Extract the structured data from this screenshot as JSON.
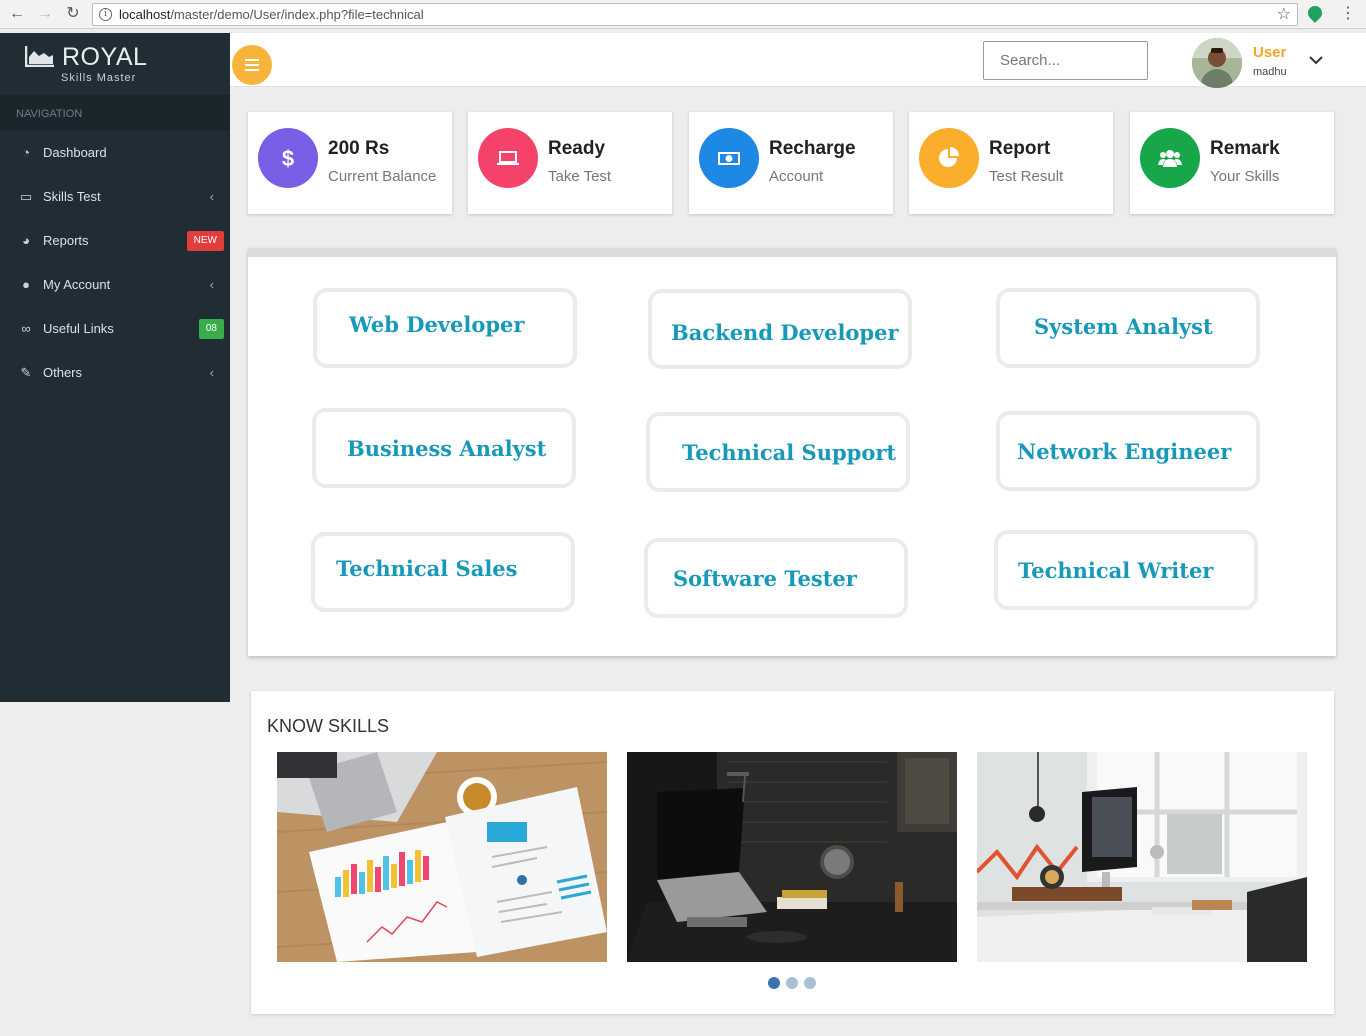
{
  "browser": {
    "url_host": "localhost",
    "url_path": "/master/demo/User/index.php?file=technical",
    "info_glyph": "i",
    "back_glyph": "←",
    "forward_glyph": "→",
    "reload_glyph": "↻",
    "star_glyph": "☆",
    "menu_glyph": "⋮"
  },
  "brand": {
    "title": "ROYAL",
    "subtitle": "Skills Master",
    "icon": "area-chart-icon"
  },
  "sidebar": {
    "header": "NAVIGATION",
    "items": [
      {
        "label": "Dashboard",
        "icon": "dashboard-icon",
        "glyph": "◔"
      },
      {
        "label": "Skills Test",
        "icon": "laptop-icon",
        "glyph": "▭",
        "caret": "‹"
      },
      {
        "label": "Reports",
        "icon": "pie-chart-icon",
        "glyph": "◕",
        "badge": "NEW",
        "badge_color": "#e23d3d"
      },
      {
        "label": "My Account",
        "icon": "user-icon",
        "glyph": "●",
        "caret": "‹"
      },
      {
        "label": "Useful Links",
        "icon": "link-icon",
        "glyph": "∞",
        "badge": "08",
        "badge_color": "#39ad49"
      },
      {
        "label": "Others",
        "icon": "edit-icon",
        "glyph": "✎",
        "caret": "‹"
      }
    ]
  },
  "header": {
    "search_placeholder": "Search...",
    "user_name": "User",
    "user_sub": "madhu"
  },
  "stats": [
    {
      "title": "200 Rs",
      "sub": "Current Balance",
      "color": "#7a5fe6",
      "icon": "dollar-icon"
    },
    {
      "title": "Ready",
      "sub": "Take Test",
      "color": "#f5426a",
      "icon": "laptop-icon"
    },
    {
      "title": "Recharge",
      "sub": "Account",
      "color": "#1e88e5",
      "icon": "money-icon"
    },
    {
      "title": "Report",
      "sub": "Test Result",
      "color": "#fbae2b",
      "icon": "pie-chart-icon"
    },
    {
      "title": "Remark",
      "sub": "Your Skills",
      "color": "#17a74a",
      "icon": "users-icon"
    }
  ],
  "skills": [
    "Web Developer",
    "Backend Developer",
    "System Analyst",
    "Business Analyst",
    "Technical Support",
    "Network Engineer",
    "Technical Sales",
    "Software Tester",
    "Technical Writer"
  ],
  "know_skills": {
    "title": "KNOW SKILLS",
    "slides": [
      "analytics-paper-photo",
      "laptop-on-desk-photo",
      "home-office-photo"
    ],
    "active_dot": 0,
    "dot_count": 3
  }
}
